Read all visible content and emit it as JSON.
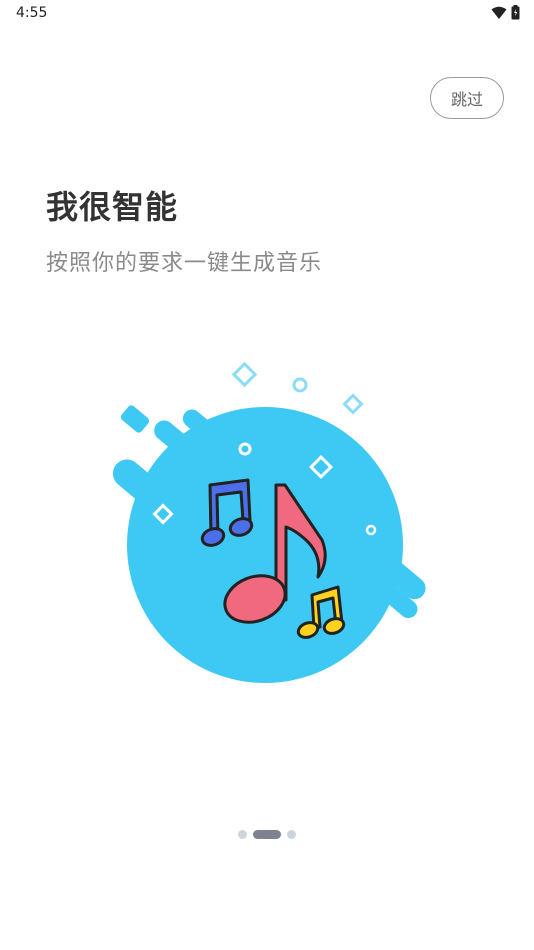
{
  "status_bar": {
    "time": "4:55"
  },
  "skip_label": "跳过",
  "headline": "我很智能",
  "subline": "按照你的要求一键生成音乐",
  "colors": {
    "accent_circle": "#3ec9f5",
    "note_red": "#f0697e",
    "note_blue": "#4a6fe8",
    "note_yellow": "#ffd21f"
  },
  "icons": [
    "wifi-icon",
    "battery-icon",
    "music-notes-illustration"
  ],
  "pager": {
    "total": 3,
    "active_index": 1
  }
}
